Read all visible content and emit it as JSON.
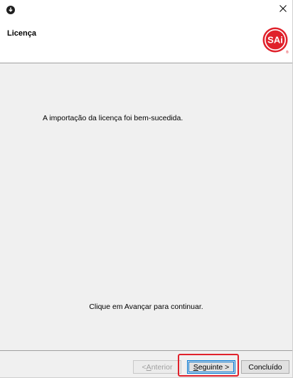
{
  "titlebar": {
    "app_icon": "download-circle-icon",
    "close_glyph": "×"
  },
  "header": {
    "title": "Licença",
    "logo_text": "SAi"
  },
  "content": {
    "success_message": "A importação da licença foi bem-sucedida.",
    "continue_message": "Clique em Avançar para continuar."
  },
  "footer": {
    "prev_prefix": "< ",
    "prev_accel": "A",
    "prev_rest": "nterior",
    "next_accel": "S",
    "next_rest": "eguinte >",
    "finish_label": "Concluído"
  },
  "colors": {
    "logo_red": "#e0212b",
    "highlight_red": "#e0212b",
    "focus_blue": "#0078d7"
  }
}
